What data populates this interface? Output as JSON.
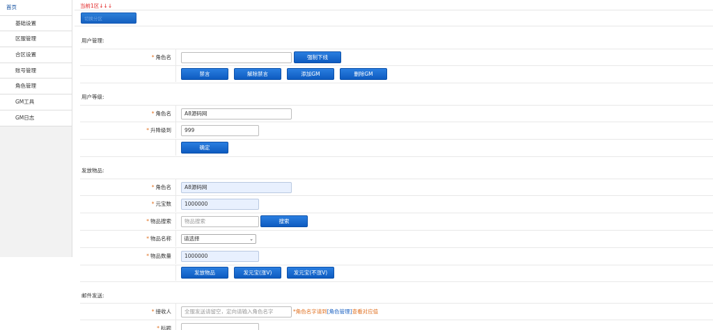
{
  "sidebar": {
    "items": [
      {
        "label": "首页"
      },
      {
        "label": "基础设置"
      },
      {
        "label": "区服管理"
      },
      {
        "label": "合区设置"
      },
      {
        "label": "账号管理"
      },
      {
        "label": "角色管理"
      },
      {
        "label": "GM工具"
      },
      {
        "label": "GM日志"
      }
    ]
  },
  "header": {
    "zone_text": "当前1区↓↓↓",
    "select_zone_label": "切换分区"
  },
  "user_manage": {
    "title": "用户管理:",
    "role_label": "角色名",
    "role_value": "",
    "force_offline_label": "强制下线",
    "mute_label": "禁言",
    "unmute_label": "解除禁言",
    "add_gm_label": "添加GM",
    "remove_gm_label": "删除GM"
  },
  "user_level": {
    "title": "用户等级:",
    "role_label": "角色名",
    "role_value": "A8源码网",
    "level_label": "升降级到",
    "level_value": "999",
    "confirm_label": "确定"
  },
  "send_items": {
    "title": "发放物品:",
    "role_label": "角色名",
    "role_value": "A8源码网",
    "yuanbao_label": "元宝数",
    "yuanbao_value": "1000000",
    "search_label": "物品搜索",
    "search_placeholder": "物品搜索",
    "search_button": "搜索",
    "item_name_label": "物品名称",
    "item_name_selected": "请选择",
    "item_qty_label": "物品数量",
    "item_qty_value": "1000000",
    "send_item_button": "发放物品",
    "send_yuanbao_v_button": "发元宝(涨V)",
    "send_yuanbao_nov_button": "发元宝(不涨V)"
  },
  "mail": {
    "title": "邮件发送:",
    "receiver_label": "接收人",
    "receiver_placeholder": "全服发送请留空，定向请输入角色名字",
    "hint_prefix": "*角色名字请到",
    "hint_link": "[角色管理]",
    "hint_suffix": "查看对应值",
    "subject_label": "标题"
  },
  "colors": {
    "accent": "#1560c0",
    "required": "#e07020",
    "zone_text": "#e02020"
  }
}
